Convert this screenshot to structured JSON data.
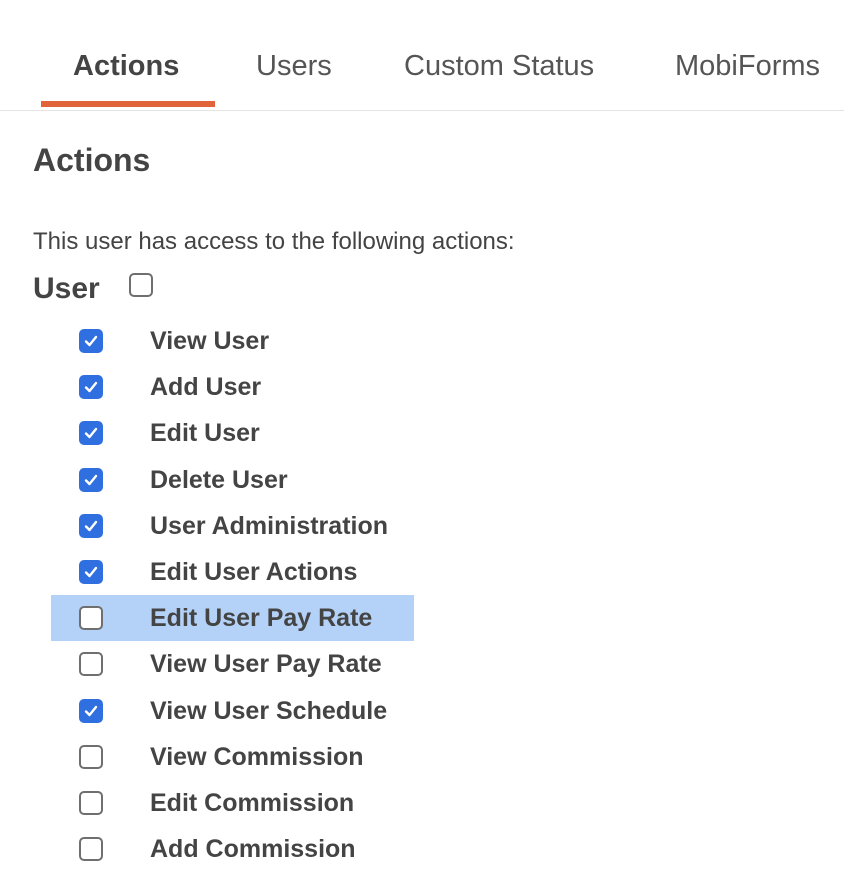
{
  "tabs": [
    {
      "label": "Actions",
      "active": true
    },
    {
      "label": "Users",
      "active": false
    },
    {
      "label": "Custom Status",
      "active": false
    },
    {
      "label": "MobiForms",
      "active": false
    }
  ],
  "accent_color": "#e0633a",
  "checkbox_color": "#2f6fe0",
  "highlight_color": "#b4d2f8",
  "section": {
    "title": "Actions",
    "intro": "This user has access to the following actions:",
    "group": {
      "label": "User",
      "checked": false,
      "items": [
        {
          "label": "View User",
          "checked": true,
          "highlighted": false
        },
        {
          "label": "Add User",
          "checked": true,
          "highlighted": false
        },
        {
          "label": "Edit User",
          "checked": true,
          "highlighted": false
        },
        {
          "label": "Delete User",
          "checked": true,
          "highlighted": false
        },
        {
          "label": "User Administration",
          "checked": true,
          "highlighted": false
        },
        {
          "label": "Edit User Actions",
          "checked": true,
          "highlighted": false
        },
        {
          "label": "Edit User Pay Rate",
          "checked": false,
          "highlighted": true
        },
        {
          "label": "View User Pay Rate",
          "checked": false,
          "highlighted": false
        },
        {
          "label": "View User Schedule",
          "checked": true,
          "highlighted": false
        },
        {
          "label": "View Commission",
          "checked": false,
          "highlighted": false
        },
        {
          "label": "Edit Commission",
          "checked": false,
          "highlighted": false
        },
        {
          "label": "Add Commission",
          "checked": false,
          "highlighted": false
        }
      ]
    }
  }
}
